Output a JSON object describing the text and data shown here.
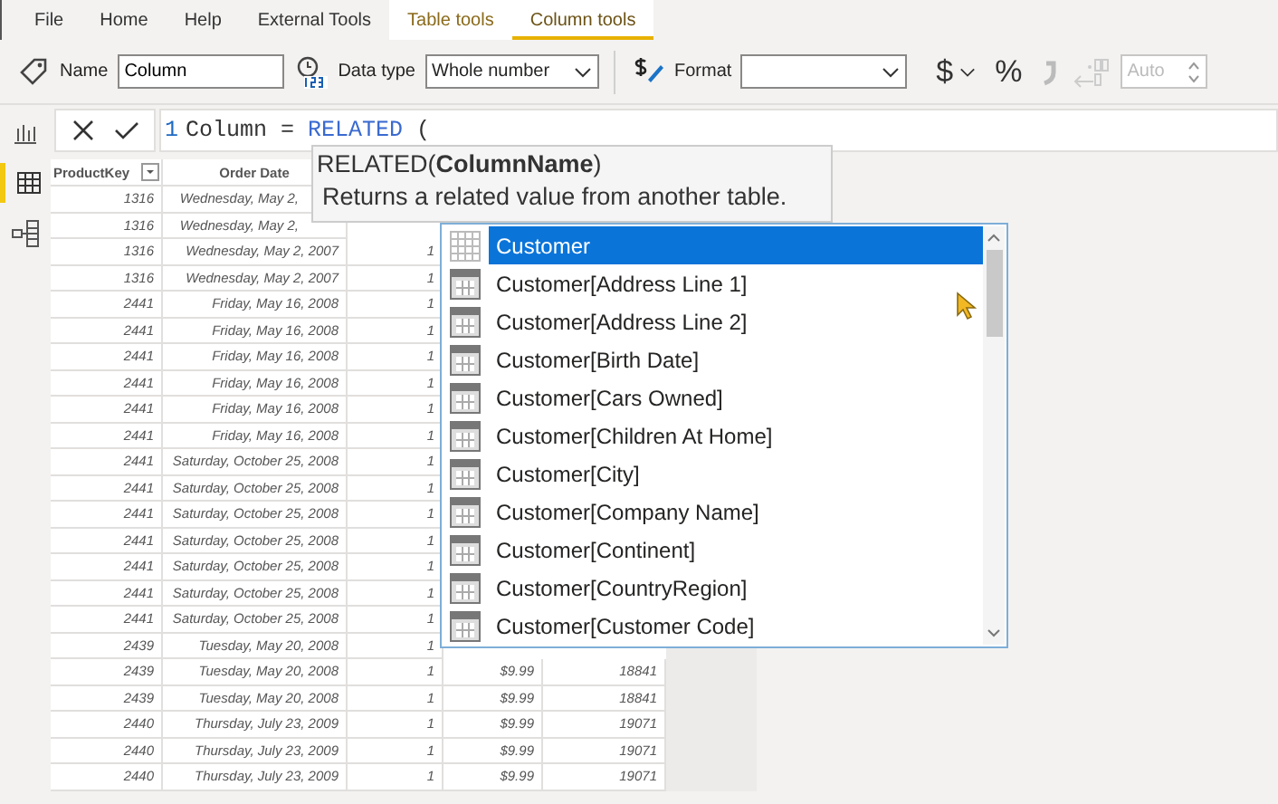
{
  "ribbon_tabs": [
    {
      "label": "File",
      "selected": false,
      "contextual": false
    },
    {
      "label": "Home",
      "selected": false,
      "contextual": false
    },
    {
      "label": "Help",
      "selected": false,
      "contextual": false
    },
    {
      "label": "External Tools",
      "selected": false,
      "contextual": false
    },
    {
      "label": "Table tools",
      "selected": false,
      "contextual": true
    },
    {
      "label": "Column tools",
      "selected": true,
      "contextual": true
    }
  ],
  "toolbar": {
    "name_label": "Name",
    "name_value": "Column",
    "data_type_label": "Data type",
    "data_type_value": "Whole number",
    "format_label": "Format",
    "currency": "$",
    "percent": "%",
    "auto_value": "Auto",
    "auto_disabled": true
  },
  "sidebar": [
    {
      "kind": "report",
      "selected": false
    },
    {
      "kind": "data",
      "selected": true
    },
    {
      "kind": "model",
      "selected": false
    }
  ],
  "formula": {
    "line_number": "1",
    "tokens": [
      {
        "text": "Column = ",
        "kind": "plain"
      },
      {
        "text": "RELATED",
        "kind": "keyword"
      },
      {
        "text": " (",
        "kind": "plain"
      }
    ]
  },
  "table": {
    "columns": [
      {
        "label": "ProductKey",
        "filter": true
      },
      {
        "label": "Order Date",
        "filter": false
      }
    ],
    "rows": [
      {
        "cells": [
          "1316",
          "Wednesday, May 2,",
          null,
          null,
          null
        ]
      },
      {
        "cells": [
          "1316",
          "Wednesday, May 2,",
          null,
          null,
          null
        ]
      },
      {
        "cells": [
          "1316",
          "Wednesday, May 2, 2007",
          "1",
          null,
          null
        ]
      },
      {
        "cells": [
          "1316",
          "Wednesday, May 2, 2007",
          "1",
          null,
          null
        ]
      },
      {
        "cells": [
          "2441",
          "Friday, May 16, 2008",
          "1",
          null,
          null
        ]
      },
      {
        "cells": [
          "2441",
          "Friday, May 16, 2008",
          "1",
          null,
          null
        ]
      },
      {
        "cells": [
          "2441",
          "Friday, May 16, 2008",
          "1",
          null,
          null
        ]
      },
      {
        "cells": [
          "2441",
          "Friday, May 16, 2008",
          "1",
          null,
          null
        ]
      },
      {
        "cells": [
          "2441",
          "Friday, May 16, 2008",
          "1",
          null,
          null
        ]
      },
      {
        "cells": [
          "2441",
          "Friday, May 16, 2008",
          "1",
          null,
          null
        ]
      },
      {
        "cells": [
          "2441",
          "Saturday, October 25, 2008",
          "1",
          null,
          null
        ]
      },
      {
        "cells": [
          "2441",
          "Saturday, October 25, 2008",
          "1",
          null,
          null
        ]
      },
      {
        "cells": [
          "2441",
          "Saturday, October 25, 2008",
          "1",
          null,
          null
        ]
      },
      {
        "cells": [
          "2441",
          "Saturday, October 25, 2008",
          "1",
          null,
          null
        ]
      },
      {
        "cells": [
          "2441",
          "Saturday, October 25, 2008",
          "1",
          null,
          null
        ]
      },
      {
        "cells": [
          "2441",
          "Saturday, October 25, 2008",
          "1",
          null,
          null
        ]
      },
      {
        "cells": [
          "2441",
          "Saturday, October 25, 2008",
          "1",
          null,
          null
        ]
      },
      {
        "cells": [
          "2439",
          "Tuesday, May 20, 2008",
          "1",
          null,
          null
        ]
      },
      {
        "cells": [
          "2439",
          "Tuesday, May 20, 2008",
          "1",
          "$9.99",
          "18841"
        ]
      },
      {
        "cells": [
          "2439",
          "Tuesday, May 20, 2008",
          "1",
          "$9.99",
          "18841"
        ]
      },
      {
        "cells": [
          "2440",
          "Thursday, July 23, 2009",
          "1",
          "$9.99",
          "19071"
        ]
      },
      {
        "cells": [
          "2440",
          "Thursday, July 23, 2009",
          "1",
          "$9.99",
          "19071"
        ]
      },
      {
        "cells": [
          "2440",
          "Thursday, July 23, 2009",
          "1",
          "$9.99",
          "19071"
        ]
      }
    ]
  },
  "tooltip": {
    "signature": "RELATED(**ColumnName**)",
    "description": "Returns a related value from another table."
  },
  "autocomplete": {
    "items": [
      {
        "label": "Customer",
        "kind": "table",
        "selected": true
      },
      {
        "label": "Customer[Address Line 1]",
        "kind": "column",
        "selected": false
      },
      {
        "label": "Customer[Address Line 2]",
        "kind": "column",
        "selected": false
      },
      {
        "label": "Customer[Birth Date]",
        "kind": "column",
        "selected": false
      },
      {
        "label": "Customer[Cars Owned]",
        "kind": "column",
        "selected": false
      },
      {
        "label": "Customer[Children At Home]",
        "kind": "column",
        "selected": false
      },
      {
        "label": "Customer[City]",
        "kind": "column",
        "selected": false
      },
      {
        "label": "Customer[Company Name]",
        "kind": "column",
        "selected": false
      },
      {
        "label": "Customer[Continent]",
        "kind": "column",
        "selected": false
      },
      {
        "label": "Customer[CountryRegion]",
        "kind": "column",
        "selected": false
      },
      {
        "label": "Customer[Customer Code]",
        "kind": "column",
        "selected": false
      }
    ]
  }
}
